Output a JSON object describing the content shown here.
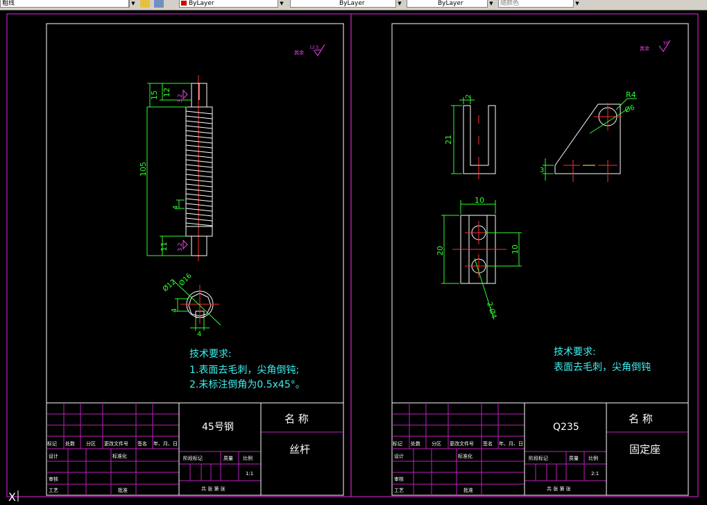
{
  "toolbar": {
    "layer_text": "粗线",
    "color_text": "ByLayer",
    "linetype_text": "ByLayer",
    "lineweight_text": "ByLayer",
    "plotstyle_text": "随颜色"
  },
  "sheet1": {
    "roughness_note": "其余",
    "roughness_value": "12.5",
    "dims": {
      "d15": "15",
      "d12": "12",
      "d105": "105",
      "d4": "4",
      "d11": "11",
      "phi16": "Ø16",
      "phi12": "Ø12",
      "d4b": "4",
      "d4c": "4"
    },
    "rough_marks": [
      "3.2",
      "3.2"
    ],
    "tech_title": "技术要求:",
    "tech_lines": [
      "1.表面去毛刺，尖角倒钝;",
      "2.未标注倒角为0.5x45°。"
    ],
    "material": "45号钢",
    "name_label": "名  称",
    "part_name": "丝杆",
    "scale": "1:1"
  },
  "sheet2": {
    "roughness_note": "其余",
    "roughness_value": "50",
    "dims": {
      "d2": "2",
      "d21": "21",
      "r4": "R4",
      "phi6": "Ø6",
      "d3": "3",
      "d10a": "10",
      "d20": "20",
      "d10b": "10",
      "holes": "2-Ø4"
    },
    "tech_title": "技术要求:",
    "tech_lines": [
      "表面去毛刺，尖角倒钝"
    ],
    "material": "Q235",
    "name_label": "名  称",
    "part_name": "固定座",
    "scale": "2:1"
  },
  "title_block": {
    "c1": "标记",
    "c2": "处数",
    "c3": "分区",
    "c4": "更改文件号",
    "c5": "签名",
    "c6": "年、月、日",
    "design": "设计",
    "standard": "标准化",
    "stage": "阶段标记",
    "weight": "质量",
    "ratio": "比例",
    "review": "审核",
    "process": "工艺",
    "approve": "批准",
    "sheets": "共  张  第  张"
  },
  "ucs_label": "X"
}
